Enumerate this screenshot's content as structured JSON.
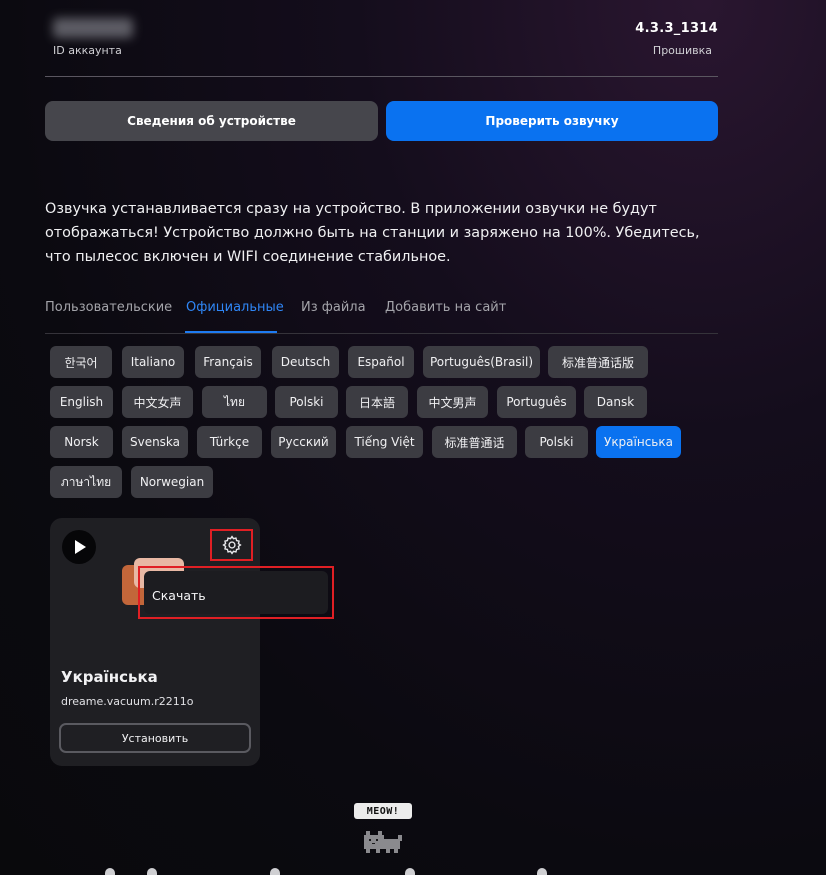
{
  "header": {
    "account_id_label": "ID аккаунта",
    "firmware_value": "4.3.3_1314",
    "firmware_label": "Прошивка"
  },
  "buttons": {
    "device_info": "Сведения об устройстве",
    "check_voice": "Проверить озвучку"
  },
  "description": "Озвучка устанавливается сразу на устройство. В приложении озвучки не будут отображаться! Устройство должно быть на станции и заряжено на 100%. Убедитесь, что пылесос включен и WIFI соединение стабильное.",
  "tabs": [
    {
      "label": "Пользовательские"
    },
    {
      "label": "Официальные",
      "active": true
    },
    {
      "label": "Из файла"
    },
    {
      "label": "Добавить на сайт"
    }
  ],
  "languages": [
    "한국어",
    "Italiano",
    "Français",
    "Deutsch",
    "Español",
    "Português(Brasil)",
    "标准普通话版",
    "English",
    "中文女声",
    "ไทย",
    "Polski",
    "日本語",
    "中文男声",
    "Português",
    "Dansk",
    "Norsk",
    "Svenska",
    "Türkçe",
    "Русский",
    "Tiếng Việt",
    "标准普通话",
    "Polski",
    "Українська",
    "ภาษาไทย",
    "Norwegian"
  ],
  "selected_language": "Українська",
  "card": {
    "title": "Українська",
    "model": "dreame.vacuum.r2211o",
    "install_label": "Установить",
    "menu_item": "Скачать"
  },
  "mascot": {
    "bubble": "MEOW!"
  },
  "colors": {
    "accent": "#0a72f0",
    "highlight": "#e01f24"
  }
}
